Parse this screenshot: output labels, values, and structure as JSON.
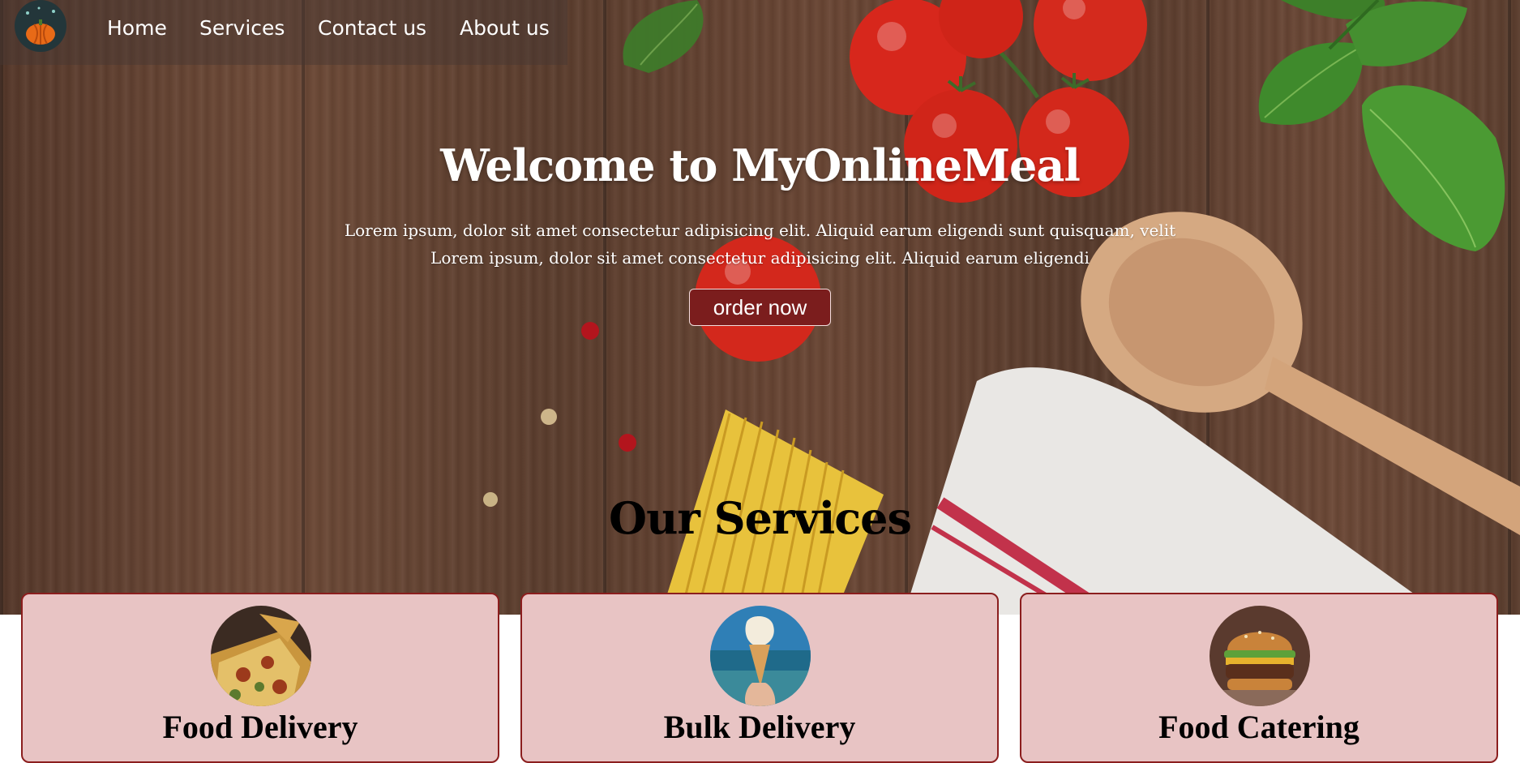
{
  "nav": {
    "logo_icon": "pumpkin-logo-icon",
    "items": [
      {
        "label": "Home"
      },
      {
        "label": "Services"
      },
      {
        "label": "Contact us"
      },
      {
        "label": "About us"
      }
    ]
  },
  "hero": {
    "title": "Welcome to MyOnlineMeal",
    "line1": "Lorem ipsum, dolor sit amet consectetur adipisicing elit. Aliquid earum eligendi sunt quisquam, velit",
    "line2": "Lorem ipsum, dolor sit amet consectetur adipisicing elit. Aliquid earum eligendi",
    "order_button": "order now"
  },
  "services": {
    "heading": "Our Services",
    "cards": [
      {
        "title": "Food Delivery",
        "image": "pizza-image"
      },
      {
        "title": "Bulk Delivery",
        "image": "ice-cream-cone-image"
      },
      {
        "title": "Food Catering",
        "image": "burger-image"
      }
    ]
  },
  "colors": {
    "button": "#7b1d1d",
    "card_background": "#e8c4c4",
    "card_border": "#8b1e1e"
  }
}
